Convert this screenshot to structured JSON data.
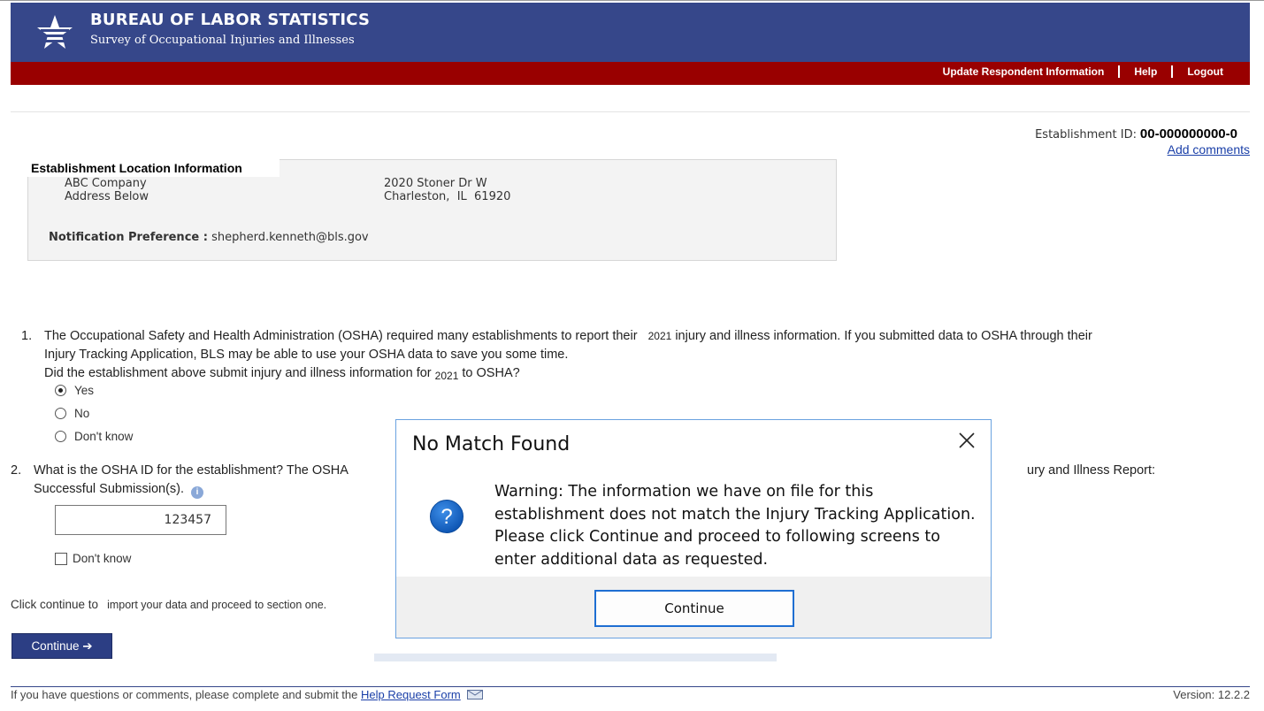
{
  "header": {
    "agency_title": "BUREAU OF LABOR STATISTICS",
    "survey_name": "Survey of Occupational Injuries and Illnesses"
  },
  "nav": {
    "update_info": "Update Respondent Information",
    "help": "Help",
    "logout": "Logout"
  },
  "establishment": {
    "id_label": "Establishment ID:",
    "id_value": "00-000000000-0",
    "add_comments": "Add comments"
  },
  "location": {
    "title": "Establishment Location Information",
    "company": "ABC Company",
    "address_note": "Address Below",
    "street": "2020 Stoner Dr W",
    "city_state_zip": "Charleston,  IL  61920",
    "notification_label": "Notification Preference :",
    "notification_value": "shepherd.kenneth@bls.gov"
  },
  "question1": {
    "number": "1.",
    "line1": "The Occupational Safety and Health Administration (OSHA) required many establishments to report their",
    "year": "2021",
    "line1_rest": "injury and illness information. If you submitted data to OSHA through their",
    "line2": "Injury Tracking Application, BLS may be able to use your OSHA data to save you some time.",
    "line3_start": "Did the establishment above submit injury and illness information for",
    "line3_year": "2021",
    "line3_end": "to OSHA?",
    "options": [
      {
        "label": "Yes",
        "checked": true
      },
      {
        "label": "No",
        "checked": false
      },
      {
        "label": "Don't know",
        "checked": false
      }
    ]
  },
  "question2": {
    "number": "2.",
    "text_start": "What is the OSHA ID for the establishment? The OSHA",
    "text_end": "ury and Illness Report:",
    "line2": "Successful Submission(s).",
    "input_value": "123457",
    "dont_know": "Don't know"
  },
  "instructions": {
    "click_continue": "Click continue to",
    "rest": "import your data and proceed to section one."
  },
  "continue_button": "Continue ➔",
  "footer": {
    "text": "If you have questions or comments, please complete and submit the",
    "link": "Help Request Form",
    "version": "Version: 12.2.2"
  },
  "modal": {
    "title": "No Match Found",
    "message": "Warning: The information we have on file for this establishment does not match the Injury Tracking Application. Please click Continue and proceed to following screens to enter additional data as requested.",
    "button": "Continue"
  },
  "colors": {
    "banner": "#36478a",
    "navbar": "#990000",
    "link": "#1a3fa8",
    "modal_border": "#6aa2e0",
    "question_icon": "#1e6ed2"
  },
  "icons": {
    "logo": "bls-eagle-star-icon",
    "close": "close-icon",
    "question": "question-icon",
    "info": "info-icon",
    "mail": "mail-icon"
  }
}
